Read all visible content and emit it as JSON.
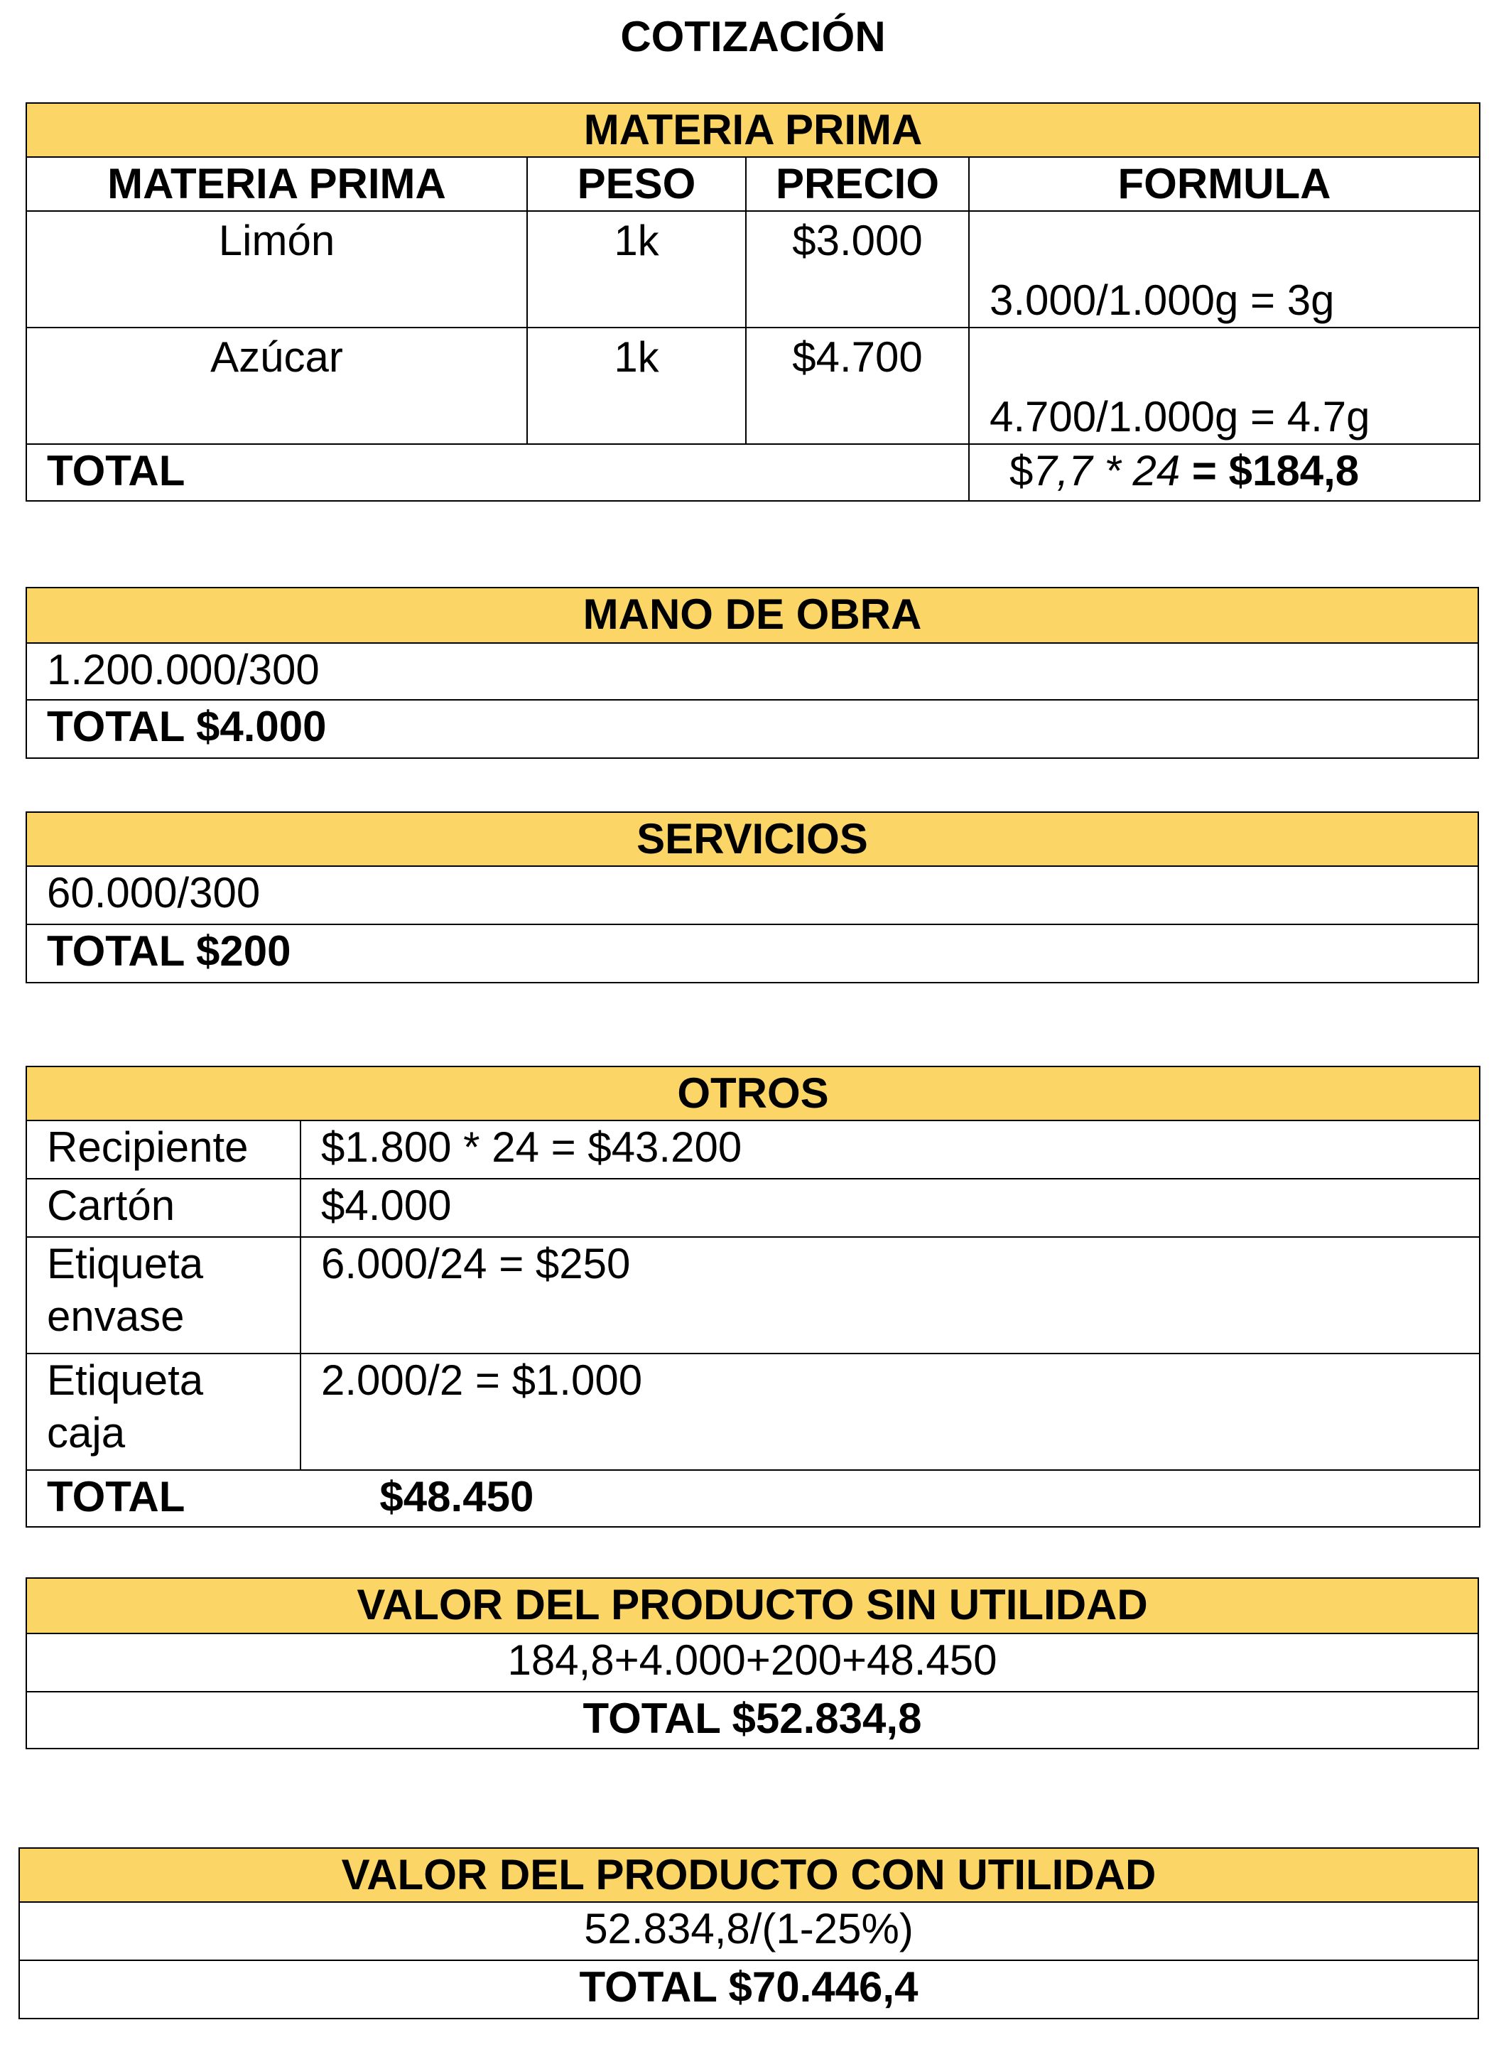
{
  "title": "COTIZACIÓN",
  "materia_prima": {
    "header": "MATERIA PRIMA",
    "columns": [
      "MATERIA PRIMA",
      "PESO",
      "PRECIO",
      "FORMULA"
    ],
    "rows": [
      {
        "materia": "Limón",
        "peso": "1k",
        "precio": "$3.000",
        "formula": "3.000/1.000g = 3g"
      },
      {
        "materia": "Azúcar",
        "peso": "1k",
        "precio": "$4.700",
        "formula": "4.700/1.000g = 4.7g"
      }
    ],
    "total_label": "TOTAL",
    "total_prefix": "$",
    "total_expr": "7,7 * 24",
    "total_result": " = $184,8"
  },
  "mano_de_obra": {
    "header": "MANO DE OBRA",
    "formula": "1.200.000/300",
    "total": "TOTAL $4.000"
  },
  "servicios": {
    "header": "SERVICIOS",
    "formula": "60.000/300",
    "total": "TOTAL $200"
  },
  "otros": {
    "header": "OTROS",
    "rows": [
      {
        "item": "Recipiente",
        "value": "$1.800 * 24 = $43.200"
      },
      {
        "item": "Cartón",
        "value": "$4.000"
      },
      {
        "item": "Etiqueta envase",
        "value": "6.000/24 = $250"
      },
      {
        "item": "Etiqueta caja",
        "value": "2.000/2 = $1.000"
      }
    ],
    "total_label": "TOTAL",
    "total_value": "$48.450"
  },
  "sin_utilidad": {
    "header": "VALOR DEL PRODUCTO SIN UTILIDAD",
    "formula": "184,8+4.000+200+48.450",
    "total": "TOTAL $52.834,8"
  },
  "con_utilidad": {
    "header": "VALOR DEL PRODUCTO CON UTILIDAD",
    "formula": "52.834,8/(1-25%)",
    "total": "TOTAL $70.446,4"
  }
}
